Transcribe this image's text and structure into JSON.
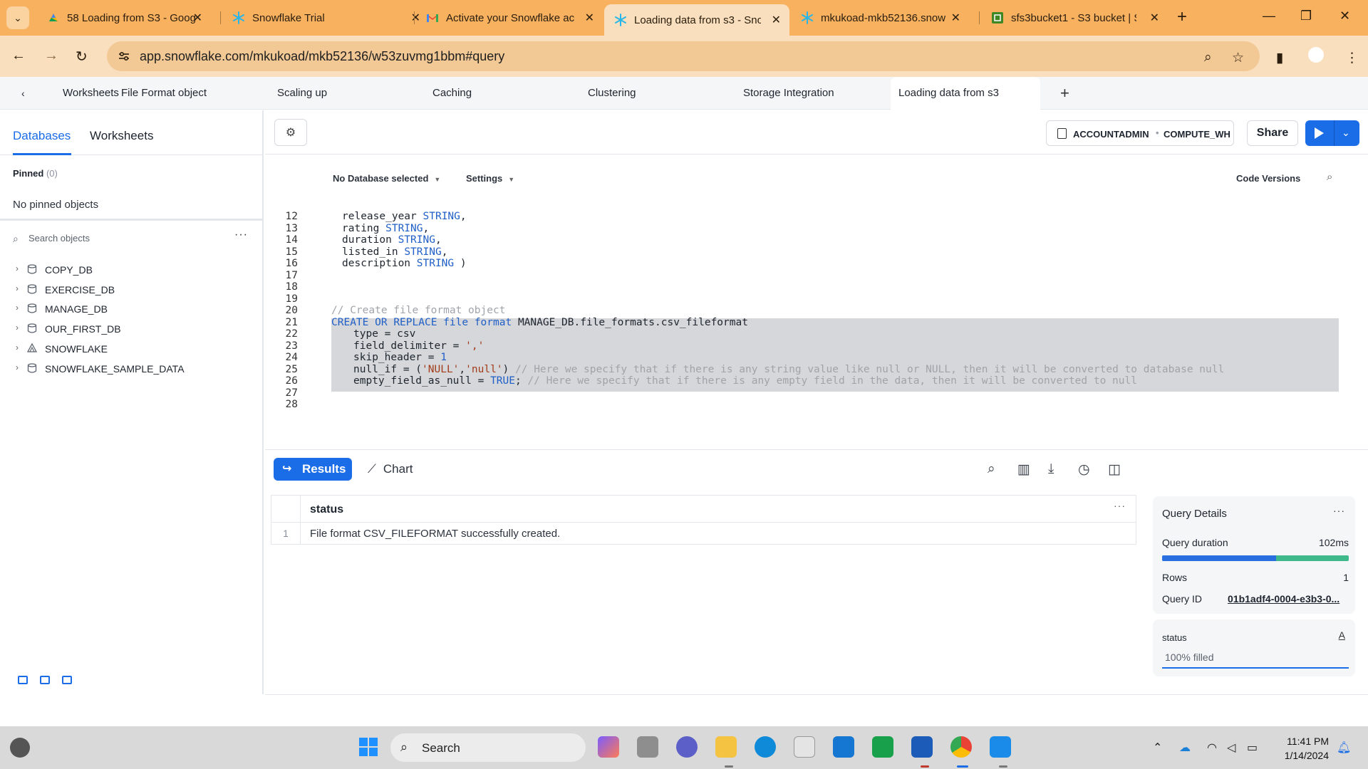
{
  "browser": {
    "tabs": [
      {
        "label": "58 Loading from S3 - Goog",
        "icon": "google-slides-icon",
        "color": "#f4b400"
      },
      {
        "label": "Snowflake Trial",
        "icon": "snowflake-icon",
        "color": "#29b5e8"
      },
      {
        "label": "Activate your Snowflake ac",
        "icon": "gmail-icon",
        "color": "#ea4335"
      },
      {
        "label": "Loading data from s3 - Sno",
        "icon": "snowflake-icon",
        "color": "#29b5e8",
        "active": true
      },
      {
        "label": "mkukoad-mkb52136.snow",
        "icon": "snowflake-icon",
        "color": "#29b5e8"
      },
      {
        "label": "sfs3bucket1 - S3 bucket | S",
        "icon": "aws-s3-icon",
        "color": "#3f8624"
      }
    ],
    "url": "app.snowflake.com/mkukoad/mkb52136/w53zuvmg1bbm#query"
  },
  "worksheet_tabs": {
    "back_label": "Worksheets",
    "tabs": [
      "File Format object",
      "Scaling up",
      "Caching",
      "Clustering",
      "Storage Integration",
      "Loading data from s3"
    ],
    "active": "Loading data from s3"
  },
  "left_panel": {
    "tabs": [
      "Databases",
      "Worksheets"
    ],
    "pinned_label": "Pinned",
    "pinned_count": "(0)",
    "no_pinned": "No pinned objects",
    "search_placeholder": "Search objects",
    "databases": [
      {
        "name": "COPY_DB",
        "icon": "database-icon"
      },
      {
        "name": "EXERCISE_DB",
        "icon": "database-icon"
      },
      {
        "name": "MANAGE_DB",
        "icon": "database-icon"
      },
      {
        "name": "OUR_FIRST_DB",
        "icon": "database-icon"
      },
      {
        "name": "SNOWFLAKE",
        "icon": "snowflake-db-icon"
      },
      {
        "name": "SNOWFLAKE_SAMPLE_DATA",
        "icon": "database-icon"
      }
    ]
  },
  "editor_header": {
    "role": "ACCOUNTADMIN",
    "warehouse": "COMPUTE_WH",
    "share_label": "Share"
  },
  "editor": {
    "database_context": "No Database selected",
    "settings_label": "Settings",
    "code_versions_label": "Code Versions",
    "lines": [
      {
        "n": "12",
        "text": "release_year STRING,"
      },
      {
        "n": "13",
        "text": "rating STRING,"
      },
      {
        "n": "14",
        "text": "duration STRING,"
      },
      {
        "n": "15",
        "text": "listed_in STRING,"
      },
      {
        "n": "16",
        "text": "description STRING )"
      },
      {
        "n": "17",
        "text": ""
      },
      {
        "n": "18",
        "text": ""
      },
      {
        "n": "19",
        "text": ""
      },
      {
        "n": "20",
        "text": "// Create file format object"
      },
      {
        "n": "21",
        "text": "CREATE OR REPLACE file format MANAGE_DB.file_formats.csv_fileformat"
      },
      {
        "n": "22",
        "text": "type = csv"
      },
      {
        "n": "23",
        "text": "field_delimiter = ','"
      },
      {
        "n": "24",
        "text": "skip_header = 1"
      },
      {
        "n": "25",
        "text": "null_if = ('NULL','null') // Here we specify that if there is any string value like null or NULL, then it will be converted to database null"
      },
      {
        "n": "26",
        "text": "empty_field_as_null = TRUE; // Here we specify that if there is any empty field in the data, then it will be converted to null"
      },
      {
        "n": "27",
        "text": ""
      },
      {
        "n": "28",
        "text": ""
      }
    ]
  },
  "results_bar": {
    "results_label": "Results",
    "chart_label": "Chart"
  },
  "results_table": {
    "column": "status",
    "rows": [
      {
        "n": "1",
        "status": "File format CSV_FILEFORMAT successfully created."
      }
    ]
  },
  "query_details": {
    "title": "Query Details",
    "duration_label": "Query duration",
    "duration_value": "102ms",
    "duration_fraction": 0.61,
    "rows_label": "Rows",
    "rows_value": "1",
    "query_id_label": "Query ID",
    "query_id_value": "01b1adf4-0004-e3b3-0..."
  },
  "status_card": {
    "title": "status",
    "filled": "100% filled"
  },
  "taskbar": {
    "search_label": "Search",
    "time": "11:41 PM",
    "date": "1/14/2024"
  }
}
